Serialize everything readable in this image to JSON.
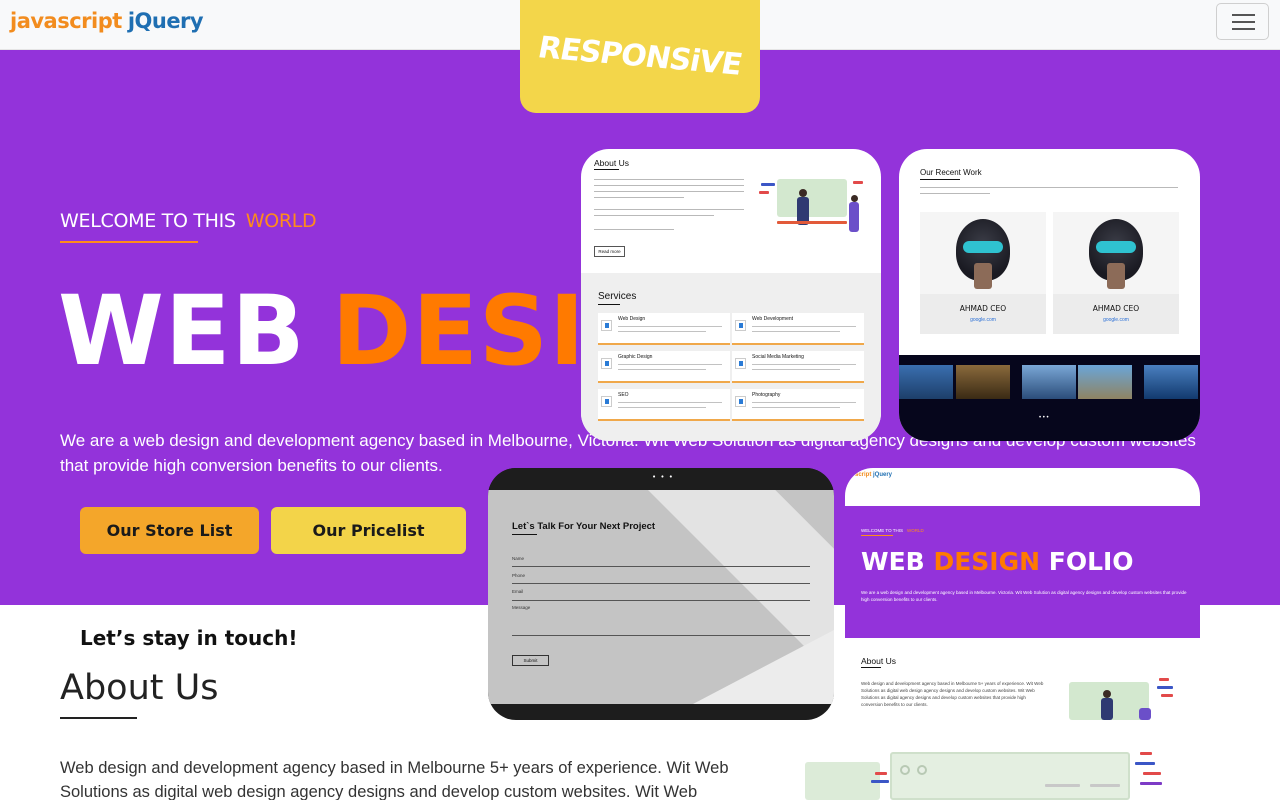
{
  "navbar": {
    "brand_part1": "javascript",
    "brand_part2": "jQuery",
    "menu_icon": "hamburger-menu-icon"
  },
  "badge": {
    "label": "RESPONSiVE"
  },
  "hero": {
    "welcome": "WELCOME TO THIS",
    "welcome_highlight": "WORLD",
    "title_white": "WEB",
    "title_orange": "DESIG",
    "description": "We are a web design and development agency based in Melbourne, Victoria. Wit Web Solution as digital agency designs and develop custom websites that provide high conversion benefits to our clients.",
    "buttons": {
      "store": "Our Store List",
      "pricelist": "Our Pricelist"
    }
  },
  "contact_tagline": "Let’s stay in touch!",
  "about": {
    "heading": "About Us",
    "text": "Web design and development agency based in Melbourne 5+ years of experience. Wit Web Solutions as digital web design agency designs and develop custom websites. Wit Web"
  },
  "preview_about": {
    "heading": "About Us",
    "read_more": "Read more",
    "services_heading": "Services",
    "services": [
      {
        "name": "Web Design"
      },
      {
        "name": "Web Development"
      },
      {
        "name": "Graphic Design"
      },
      {
        "name": "Social Media Marketing"
      },
      {
        "name": "SEO"
      },
      {
        "name": "Photography"
      }
    ]
  },
  "preview_work": {
    "heading": "Our Recent Work",
    "people": [
      {
        "name": "AHMAD CEO",
        "link": "google.com"
      },
      {
        "name": "AHMAD CEO",
        "link": "google.com"
      }
    ],
    "dots": "• • •"
  },
  "preview_contact": {
    "dots": "• • •",
    "heading": "Let`s Talk For Your Next Project",
    "fields": [
      "Name",
      "Phone",
      "Email",
      "Message"
    ],
    "submit": "Submit"
  },
  "preview_folio": {
    "brand_part1": "script",
    "brand_part2": "jQuery",
    "welcome": "WELCOME TO THIS",
    "welcome_highlight": "WORLD",
    "title_white1": "WEB",
    "title_orange": "DESIGN",
    "title_white2": "FOLIO",
    "text": "We are a web design and development agency based in Melbourne. Victoria. Wit Web Solution as digital agency designs and develop custom websites that provide high conversion benefits to our clients.",
    "about_heading": "About Us",
    "about_text": "Web design and development agency based in Melbourne 5+ years of experience. Wit Web Solutions as digital web design agency designs and develop custom websites. Wit Web Solutions as digital agency designs and develop custom websites that provide high conversion benefits to our clients."
  },
  "colors": {
    "hero_bg": "#9333da",
    "accent_orange": "#ff7a00",
    "button_store": "#f4a62a",
    "button_price": "#f3d449",
    "badge": "#f3d64a"
  }
}
